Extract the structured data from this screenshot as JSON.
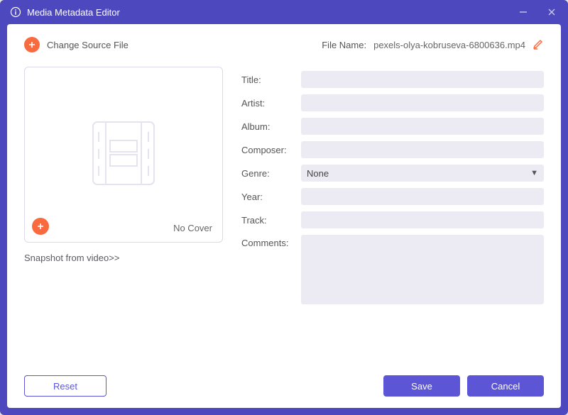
{
  "window": {
    "title": "Media Metadata Editor"
  },
  "toprow": {
    "changeSource": "Change Source File",
    "fileLabel": "File Name:",
    "fileName": "pexels-olya-kobruseva-6800636.mp4"
  },
  "cover": {
    "caption": "No Cover",
    "snapshot": "Snapshot from video>>"
  },
  "form": {
    "labels": {
      "title": "Title:",
      "artist": "Artist:",
      "album": "Album:",
      "composer": "Composer:",
      "genre": "Genre:",
      "year": "Year:",
      "track": "Track:",
      "comments": "Comments:"
    },
    "values": {
      "title": "",
      "artist": "",
      "album": "",
      "composer": "",
      "genre": "None",
      "year": "",
      "track": "",
      "comments": ""
    }
  },
  "footer": {
    "reset": "Reset",
    "save": "Save",
    "cancel": "Cancel"
  }
}
